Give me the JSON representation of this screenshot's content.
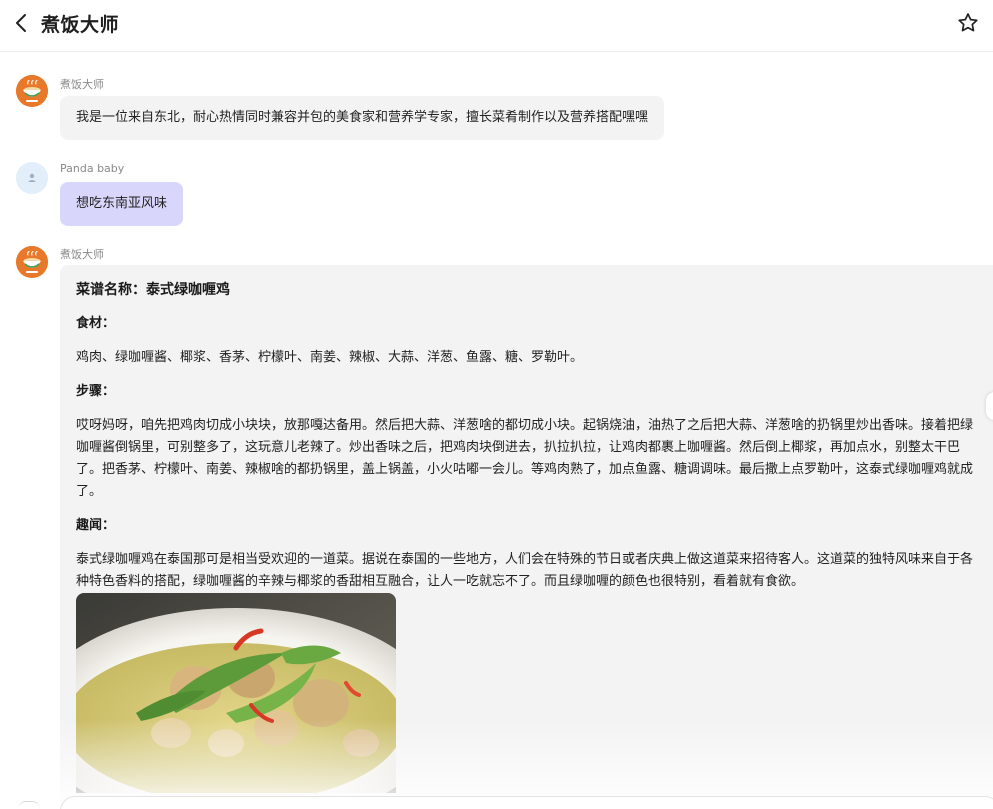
{
  "header": {
    "title": "煮饭大师"
  },
  "messages": [
    {
      "sender": "煮饭大师",
      "text": "我是一位来自东北，耐心热情同时兼容并包的美食家和营养学专家，擅长菜肴制作以及营养搭配嘿嘿"
    },
    {
      "sender": "Panda baby",
      "text": "想吃东南亚风味"
    },
    {
      "sender": "煮饭大师"
    }
  ],
  "recipe": {
    "title": "菜谱名称：泰式绿咖喱鸡",
    "ingredients_heading": "食材：",
    "ingredients": "鸡肉、绿咖喱酱、椰浆、香茅、柠檬叶、南姜、辣椒、大蒜、洋葱、鱼露、糖、罗勒叶。",
    "steps_heading": "步骤：",
    "steps": "哎呀妈呀，咱先把鸡肉切成小块块，放那嘎达备用。然后把大蒜、洋葱啥的都切成小块。起锅烧油，油热了之后把大蒜、洋葱啥的扔锅里炒出香味。接着把绿咖喱酱倒锅里，可别整多了，这玩意儿老辣了。炒出香味之后，把鸡肉块倒进去，扒拉扒拉，让鸡肉都裹上咖喱酱。然后倒上椰浆，再加点水，别整太干巴了。把香茅、柠檬叶、南姜、辣椒啥的都扔锅里，盖上锅盖，小火咕嘟一会儿。等鸡肉熟了，加点鱼露、糖调调味。最后撒上点罗勒叶，这泰式绿咖喱鸡就成了。",
    "trivia_heading": "趣闻：",
    "trivia": "泰式绿咖喱鸡在泰国那可是相当受欢迎的一道菜。据说在泰国的一些地方，人们会在特殊的节日或者庆典上做这道菜来招待客人。这道菜的独特风味来自于各种特色香料的搭配，绿咖喱酱的辛辣与椰浆的香甜相互融合，让人一吃就忘不了。而且绿咖喱的颜色也很特别，看着就有食欲。",
    "image_subject": "green-curry-chicken-photo"
  },
  "icons": {
    "back": "chevron-left-icon",
    "favorite": "star-icon",
    "bot_avatar": "chef-bowl-avatar",
    "user_avatar": "user-avatar"
  },
  "colors": {
    "user_bubble": "#d8d7fb",
    "bot_bubble": "#f3f3f3",
    "bot_avatar": "#e8782a",
    "user_avatar": "#e2eef9"
  }
}
